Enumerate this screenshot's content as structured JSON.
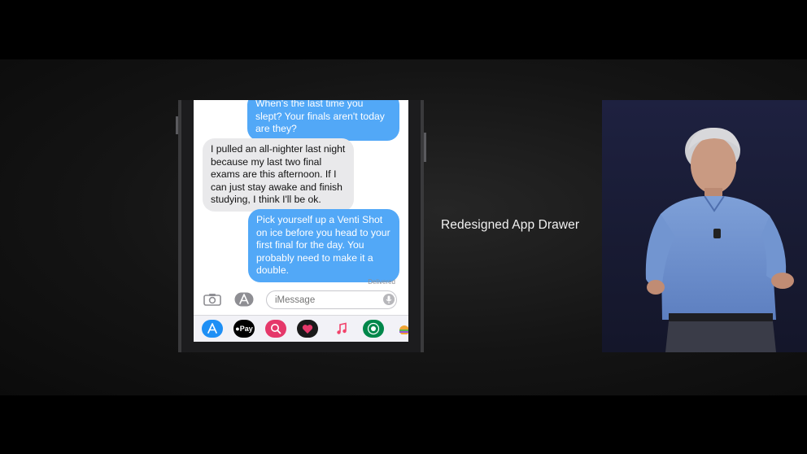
{
  "messages": [
    {
      "direction": "out",
      "text": "When's the last time you slept? Your finals aren't today are they?"
    },
    {
      "direction": "in",
      "text": "I pulled an all-nighter last night because my last two final exams are this afternoon. If I can just stay awake and finish studying, I think I'll be ok."
    },
    {
      "direction": "out",
      "text": "Pick yourself up a Venti Shot on ice before you head to your first final for the day. You probably need to make it a double."
    }
  ],
  "status": {
    "delivered": "Delivered"
  },
  "composer": {
    "placeholder": "iMessage"
  },
  "app_drawer": {
    "icons": [
      {
        "name": "app-store-icon",
        "color": "#1e8ff5"
      },
      {
        "name": "apple-pay-icon",
        "label": "Pay",
        "color": "#000000"
      },
      {
        "name": "search-images-icon",
        "color": "#e5386a"
      },
      {
        "name": "digital-touch-icon",
        "color": "#1a1a1a"
      },
      {
        "name": "music-icon",
        "color": "#ffffff"
      },
      {
        "name": "starbucks-icon",
        "color": "#00874a"
      },
      {
        "name": "stickers-icon",
        "color": "#e8a33c"
      }
    ]
  },
  "slide": {
    "caption": "Redesigned App Drawer"
  },
  "colors": {
    "outgoing_bubble": "#52a8f7",
    "incoming_bubble": "#e9e9eb",
    "stage_background": "#1a1a1a"
  }
}
